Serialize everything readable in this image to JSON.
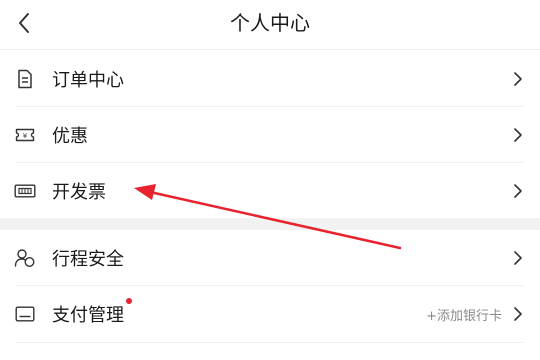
{
  "header": {
    "title": "个人中心"
  },
  "group1": [
    {
      "label": "订单中心",
      "icon": "document-icon"
    },
    {
      "label": "优惠",
      "icon": "coupon-icon"
    },
    {
      "label": "开发票",
      "icon": "invoice-icon"
    }
  ],
  "group2": [
    {
      "label": "行程安全",
      "icon": "user-shield-icon"
    },
    {
      "label": "支付管理",
      "icon": "wallet-icon",
      "extra": "+添加银行卡",
      "badge": true
    }
  ],
  "colors": {
    "accent": "#e8232e",
    "arrow": "#e8232e",
    "divider": "#efefef",
    "gap": "#f2f2f2"
  }
}
